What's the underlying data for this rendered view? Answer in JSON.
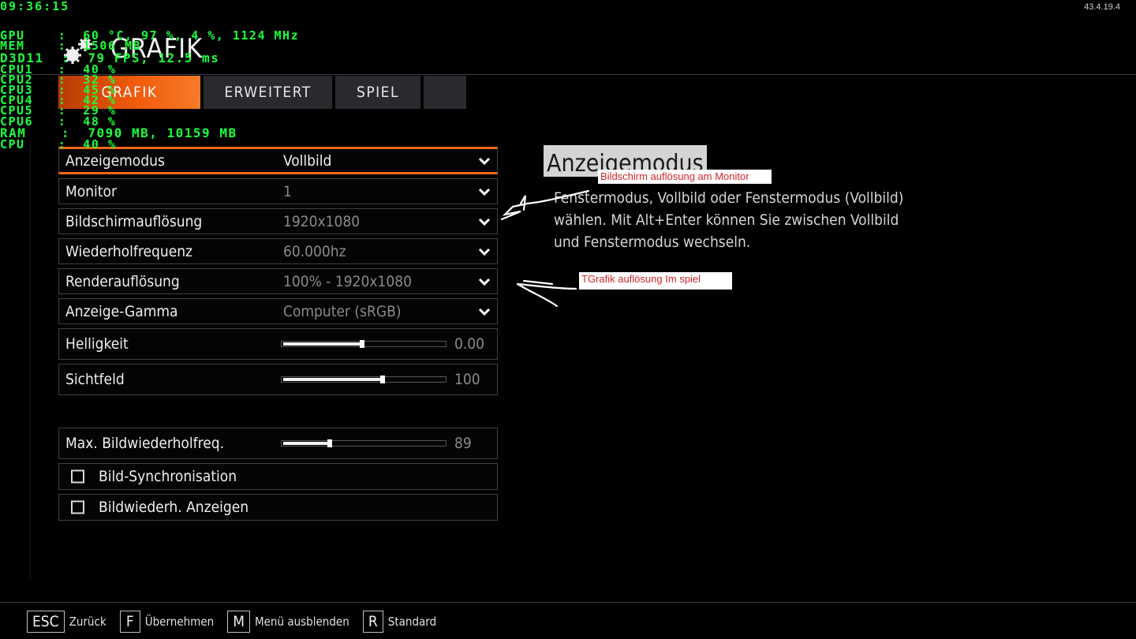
{
  "app": {
    "version": "43.4.19.4"
  },
  "header": {
    "title": "GRAFIK"
  },
  "tabs": [
    {
      "label": "GRAFIK",
      "active": true
    },
    {
      "label": "ERWEITERT",
      "active": false
    },
    {
      "label": "SPIEL",
      "active": false
    },
    {
      "label": "",
      "active": false
    }
  ],
  "settings": {
    "dropdowns": [
      {
        "label": "Anzeigemodus",
        "value": "Vollbild"
      },
      {
        "label": "Monitor",
        "value": "1"
      },
      {
        "label": "Bildschirmauflösung",
        "value": "1920x1080"
      },
      {
        "label": "Wiederholfrequenz",
        "value": "60.000hz"
      },
      {
        "label": "Renderauflösung",
        "value": "100% - 1920x1080"
      },
      {
        "label": "Anzeige-Gamma",
        "value": "Computer (sRGB)"
      }
    ],
    "sliders": [
      {
        "label": "Helligkeit",
        "value": "0.00",
        "level": 0.49
      },
      {
        "label": "Sichtfeld",
        "value": "100",
        "level": 0.62
      },
      {
        "label": "Max. Bildwiederholfreq.",
        "value": "89",
        "level": 0.29
      }
    ],
    "checkboxes": [
      {
        "label": "Bild-Synchronisation",
        "checked": false
      },
      {
        "label": "Bildwiederh. Anzeigen",
        "checked": false
      }
    ]
  },
  "description": {
    "title": "Anzeigemodus",
    "text": "Fenstermodus, Vollbild oder Fenstermodus (Vollbild) wählen. Mit Alt+Enter können Sie zwischen Vollbild und Fenstermodus wechseln."
  },
  "annotations": {
    "note_monitor": "Bildschirm auflösung am Monitor",
    "note_render": "TGrafik auflösung Im spiel"
  },
  "hud": {
    "time": "09:36:15",
    "lines": [
      "GPU    :  60 °C, 97 %, 4 %, 1124 MHz",
      "MEM    :  1506 MB",
      "D3D11  :  79 FPS, 12.5 ms",
      "CPU1   :  40 %",
      "CPU2   :  32 %",
      "CPU3   :  45 %",
      "CPU4   :  42 %",
      "CPU5   :  29 %",
      "CPU6   :  48 %",
      "RAM    :  7090 MB, 10159 MB",
      "CPU    :  40 %"
    ]
  },
  "footer": [
    {
      "key": "ESC",
      "label": "Zurück"
    },
    {
      "key": "F",
      "label": "Übernehmen"
    },
    {
      "key": "M",
      "label": "Menü ausblenden"
    },
    {
      "key": "R",
      "label": "Standard"
    }
  ],
  "colors": {
    "accent": "#f25b0b",
    "hud": "#1cff3c",
    "annotation": "#d4242a"
  }
}
